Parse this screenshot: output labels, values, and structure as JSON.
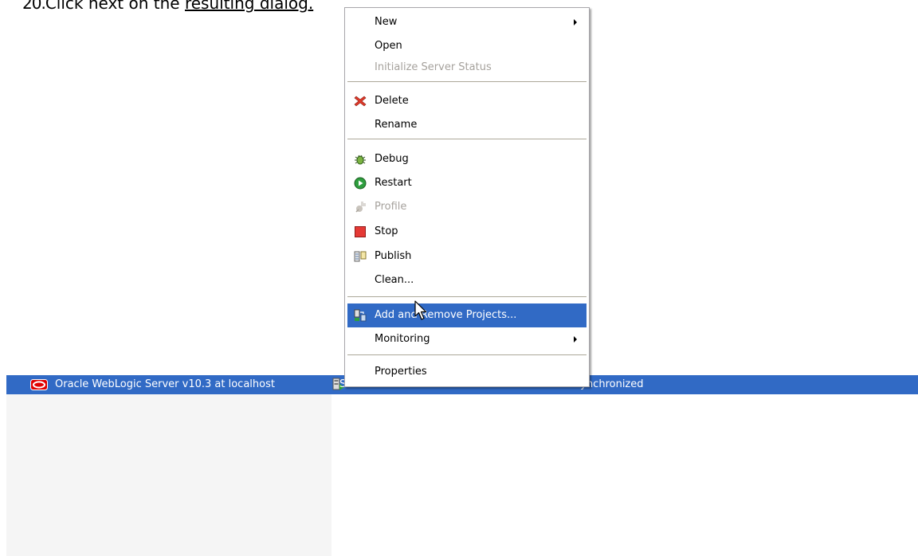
{
  "instruction": {
    "number": "20.",
    "text_plain": "Click next on the ",
    "text_underlined": "resulting dialog."
  },
  "menu": {
    "items": [
      {
        "label": "New",
        "submenu": true,
        "enabled": true
      },
      {
        "label": "Open",
        "enabled": true
      },
      {
        "label": "Initialize Server Status",
        "enabled": false
      },
      {
        "label": "Delete",
        "icon": "delete-icon",
        "enabled": true
      },
      {
        "label": "Rename",
        "enabled": true
      },
      {
        "label": "Debug",
        "icon": "debug-icon",
        "enabled": true
      },
      {
        "label": "Restart",
        "icon": "restart-icon",
        "enabled": true
      },
      {
        "label": "Profile",
        "icon": "profile-icon",
        "enabled": false
      },
      {
        "label": "Stop",
        "icon": "stop-icon",
        "enabled": true
      },
      {
        "label": "Publish",
        "icon": "publish-icon",
        "enabled": true
      },
      {
        "label": "Clean...",
        "enabled": true
      },
      {
        "label": "Add and Remove Projects...",
        "icon": "add-remove-projects-icon",
        "enabled": true,
        "highlighted": true
      },
      {
        "label": "Monitoring",
        "submenu": true,
        "enabled": true
      },
      {
        "label": "Properties",
        "enabled": true
      }
    ]
  },
  "server_row": {
    "name": "Oracle WebLogic Server v10.3 at localhost",
    "state": "Started",
    "status": "Synchronized",
    "icon": "oracle-server-icon",
    "state_icon": "server-started-icon"
  },
  "colors": {
    "selection": "#316ac5",
    "menu_border": "#a7a6aa",
    "disabled_text": "#a6a29d"
  }
}
